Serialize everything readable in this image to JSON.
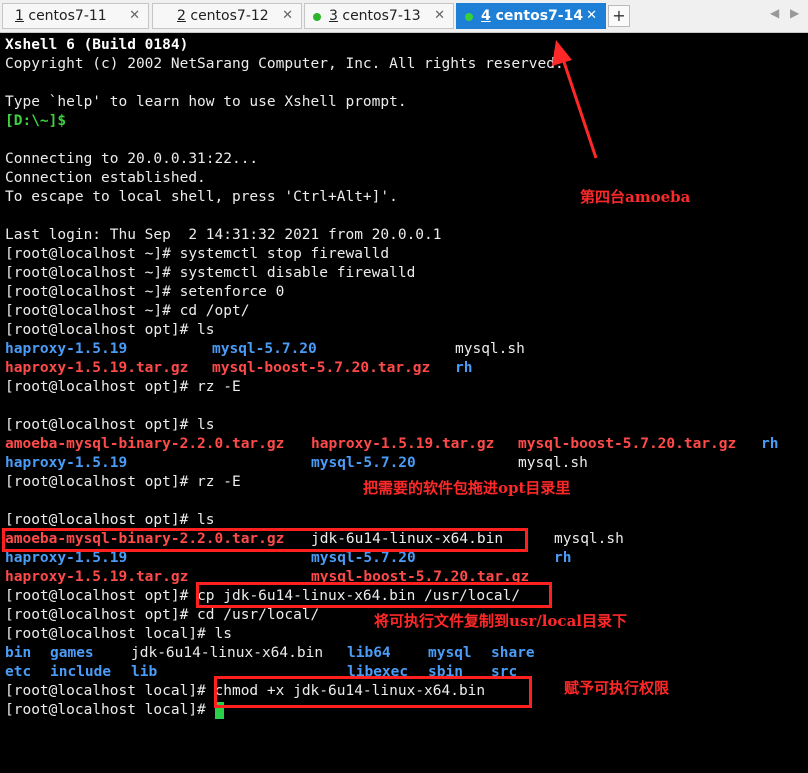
{
  "tabs": [
    {
      "num": "1",
      "title": "centos7-11",
      "dot": "",
      "active": false
    },
    {
      "num": "2",
      "title": "centos7-12",
      "dot": "",
      "active": false
    },
    {
      "num": "3",
      "title": "centos7-13",
      "dot": "#2ab52a",
      "active": false
    },
    {
      "num": "4",
      "title": "centos7-14",
      "dot": "#39d139",
      "active": true
    }
  ],
  "tab_close": "✕",
  "tab_add": "+",
  "tab_nav_left": "◀",
  "tab_nav_right": "▶",
  "terminal": {
    "l1": "Xshell 6 (Build 0184)",
    "l2": "Copyright (c) 2002 NetSarang Computer, Inc. All rights reserved.",
    "l3": "",
    "l4": "Type `help' to learn how to use Xshell prompt.",
    "l5": "[D:\\~]$",
    "l6": "",
    "l7": "Connecting to 20.0.0.31:22...",
    "l8": "Connection established.",
    "l9": "To escape to local shell, press 'Ctrl+Alt+]'.",
    "l10": "",
    "l11": "Last login: Thu Sep  2 14:31:32 2021 from 20.0.0.1",
    "l12": "[root@localhost ~]# systemctl stop firewalld",
    "l13": "[root@localhost ~]# systemctl disable firewalld",
    "l14": "[root@localhost ~]# setenforce 0",
    "l15": "[root@localhost ~]# cd /opt/",
    "l16": "[root@localhost opt]# ls",
    "ls1": {
      "a": "haproxy-1.5.19",
      "b": "mysql-5.7.20",
      "c": "mysql.sh"
    },
    "ls2": {
      "a": "haproxy-1.5.19.tar.gz",
      "b": "mysql-boost-5.7.20.tar.gz",
      "c": "rh"
    },
    "l19": "[root@localhost opt]# rz -E",
    "l20": "",
    "l21": "[root@localhost opt]# ls",
    "ls3": {
      "a": "amoeba-mysql-binary-2.2.0.tar.gz",
      "b": "haproxy-1.5.19.tar.gz",
      "c": "mysql-boost-5.7.20.tar.gz",
      "d": "rh"
    },
    "ls4": {
      "a": "haproxy-1.5.19",
      "b": "mysql-5.7.20",
      "c": "mysql.sh"
    },
    "l24": "[root@localhost opt]# rz -E",
    "l25": "",
    "l26": "[root@localhost opt]# ls",
    "ls5": {
      "a": "amoeba-mysql-binary-2.2.0.tar.gz",
      "b": "jdk-6u14-linux-x64.bin",
      "c": "mysql.sh"
    },
    "ls6": {
      "a": "haproxy-1.5.19",
      "b": "mysql-5.7.20",
      "c": "rh"
    },
    "ls7": {
      "a": "haproxy-1.5.19.tar.gz",
      "b": "mysql-boost-5.7.20.tar.gz"
    },
    "l30_prompt": "[root@localhost opt]# ",
    "l30_cmd": "cp jdk-6u14-linux-x64.bin /usr/local/",
    "l31": "[root@localhost opt]# cd /usr/local/",
    "l32": "[root@localhost local]# ls",
    "ls8": {
      "a": "bin",
      "b": "games",
      "c": "jdk-6u14-linux-x64.bin",
      "d": "lib64",
      "e": "mysql",
      "f": "share"
    },
    "ls9": {
      "a": "etc",
      "b": "include",
      "c": "lib",
      "d": "libexec",
      "e": "sbin",
      "f": "src"
    },
    "l35_prompt": "[root@localhost local]# ",
    "l35_cmd": "chmod +x jdk-6u14-linux-x64.bin",
    "l36_prompt": "[root@localhost local]# "
  },
  "annotations": {
    "a1": "第四台amoeba",
    "a2": "把需要的软件包拖进opt目录里",
    "a3": "将可执行文件复制到usr/local目录下",
    "a4": "赋予可执行权限"
  },
  "colors": {
    "annotation": "#ff2828",
    "tab_active": "#1e7fd6",
    "prompt_green": "#3ed13e",
    "dir_blue": "#4a9cf6",
    "archive_red": "#ff4a4a"
  }
}
